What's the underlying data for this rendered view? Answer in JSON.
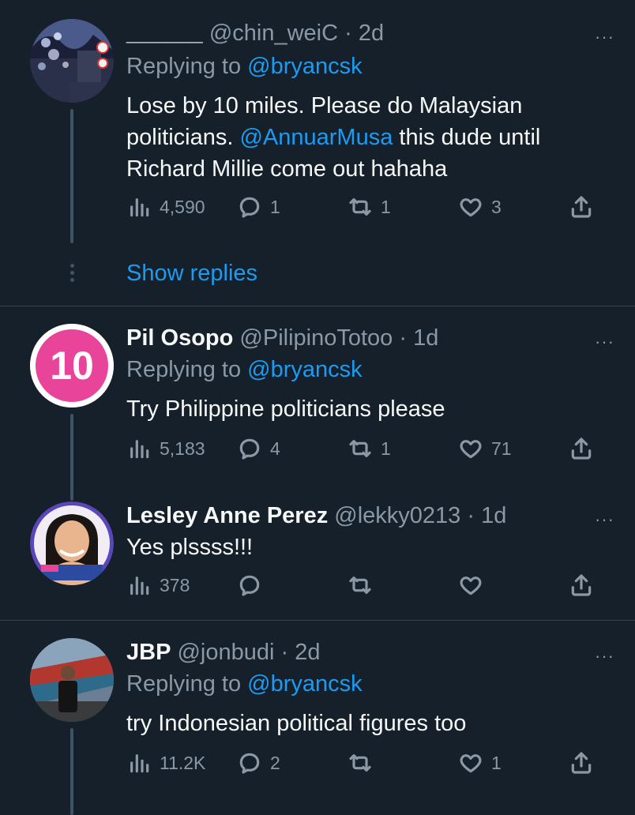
{
  "tweets": [
    {
      "name": "______",
      "handle": "@chin_weiC",
      "dot": "·",
      "time": "2d",
      "replying_prefix": "Replying to",
      "replying_to": "@bryancsk",
      "body_parts": [
        "Lose by 10 miles. Please do Malaysian politicians. ",
        "@AnnuarMusa",
        " this dude until Richard Millie come out hahaha"
      ],
      "views": "4,590",
      "replies": "1",
      "retweets": "1",
      "likes": "3",
      "more": "···"
    },
    {
      "name": "Pil Osopo",
      "handle": "@PilipinoTotoo",
      "dot": "·",
      "time": "1d",
      "replying_prefix": "Replying to",
      "replying_to": "@bryancsk",
      "body": "Try Philippine politicians please",
      "views": "5,183",
      "replies": "4",
      "retweets": "1",
      "likes": "71",
      "more": "···",
      "avatar_text": "10"
    },
    {
      "name": "Lesley Anne Perez",
      "handle": "@lekky0213",
      "dot": "·",
      "time": "1d",
      "body": "Yes plssss!!!",
      "views": "378",
      "replies": "",
      "retweets": "",
      "likes": "",
      "more": "···",
      "avatar_badge": "team LENI KIKO"
    },
    {
      "name": "JBP",
      "handle": "@jonbudi",
      "dot": "·",
      "time": "2d",
      "replying_prefix": "Replying to",
      "replying_to": "@bryancsk",
      "body": "try Indonesian political figures too",
      "views": "11.2K",
      "replies": "2",
      "retweets": "",
      "likes": "1",
      "more": "···"
    }
  ],
  "show_replies": "Show replies",
  "colors": {
    "background": "#15202b",
    "accent": "#1d9bf0",
    "muted": "#8b98a5",
    "avatar_pink": "#e8459a"
  },
  "icons": [
    "views-icon",
    "reply-icon",
    "retweet-icon",
    "like-icon",
    "share-icon",
    "more-icon"
  ]
}
